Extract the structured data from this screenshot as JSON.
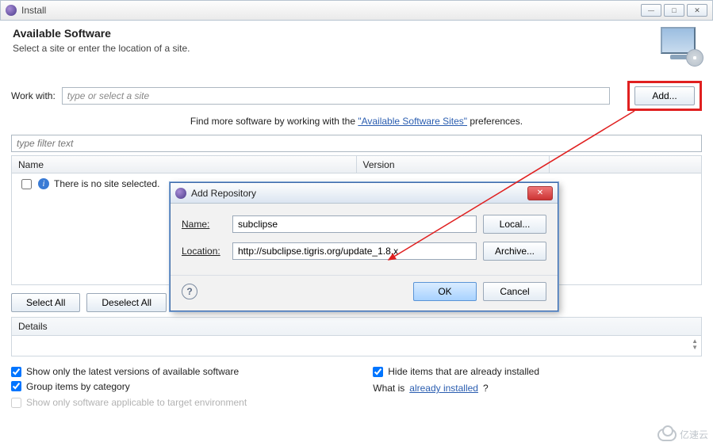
{
  "window": {
    "title": "Install"
  },
  "header": {
    "title": "Available Software",
    "subtitle": "Select a site or enter the location of a site."
  },
  "workwith": {
    "label": "Work with:",
    "placeholder": "type or select a site",
    "add_button": "Add..."
  },
  "findmore": {
    "prefix": "Find more software by working with the ",
    "link": "\"Available Software Sites\"",
    "suffix": " preferences."
  },
  "filter": {
    "placeholder": "type filter text"
  },
  "table": {
    "columns": {
      "name": "Name",
      "version": "Version"
    },
    "empty": "There is no site selected."
  },
  "buttons": {
    "select_all": "Select All",
    "deselect_all": "Deselect All"
  },
  "details": {
    "label": "Details"
  },
  "options": {
    "show_latest": "Show only the latest versions of available software",
    "group_by_category": "Group items by category",
    "show_applicable": "Show only software applicable to target environment",
    "hide_installed": "Hide items that are already installed",
    "what_is_prefix": "What is ",
    "what_is_link": "already installed",
    "what_is_suffix": "?"
  },
  "checked": {
    "show_latest": true,
    "group_by_category": true,
    "hide_installed": true
  },
  "modal": {
    "title": "Add Repository",
    "name_label": "Name:",
    "name_value": "subclipse",
    "location_label": "Location:",
    "location_value": "http://subclipse.tigris.org/update_1.8.x",
    "local_button": "Local...",
    "archive_button": "Archive...",
    "ok": "OK",
    "cancel": "Cancel"
  },
  "watermark": "亿速云"
}
